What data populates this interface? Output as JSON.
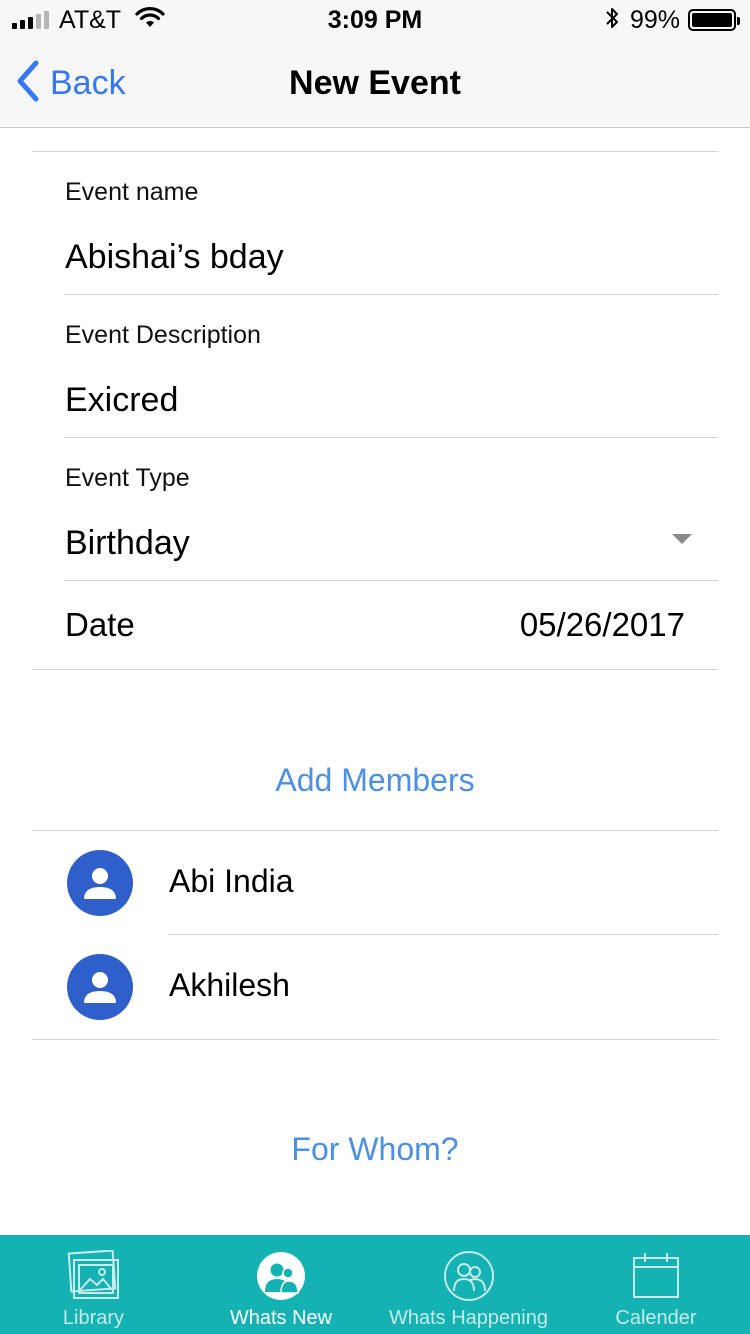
{
  "status_bar": {
    "carrier": "AT&T",
    "time": "3:09 PM",
    "battery_percent": "99%",
    "signal_bars_filled": 3,
    "signal_bars_total": 5
  },
  "nav": {
    "back_label": "Back",
    "title": "New Event",
    "accent_color": "#3478f6"
  },
  "form": {
    "event_name_label": "Event name",
    "event_name_value": "Abishai’s bday",
    "event_description_label": "Event Description",
    "event_description_value": "Exicred",
    "event_type_label": "Event Type",
    "event_type_value": "Birthday",
    "date_label": "Date",
    "date_value": "05/26/2017"
  },
  "members_section": {
    "add_members_label": "Add Members",
    "members": [
      {
        "name": "Abi India"
      },
      {
        "name": "Akhilesh"
      }
    ]
  },
  "for_whom_label": "For Whom?",
  "tab_bar": {
    "background_color": "#14b2b2",
    "tabs": [
      {
        "label": "Library",
        "icon": "photos-icon",
        "active": false
      },
      {
        "label": "Whats New",
        "icon": "people-circle-icon",
        "active": true
      },
      {
        "label": "Whats Happening",
        "icon": "people-outline-icon",
        "active": false
      },
      {
        "label": "Calender",
        "icon": "calendar-icon",
        "active": false
      }
    ]
  }
}
